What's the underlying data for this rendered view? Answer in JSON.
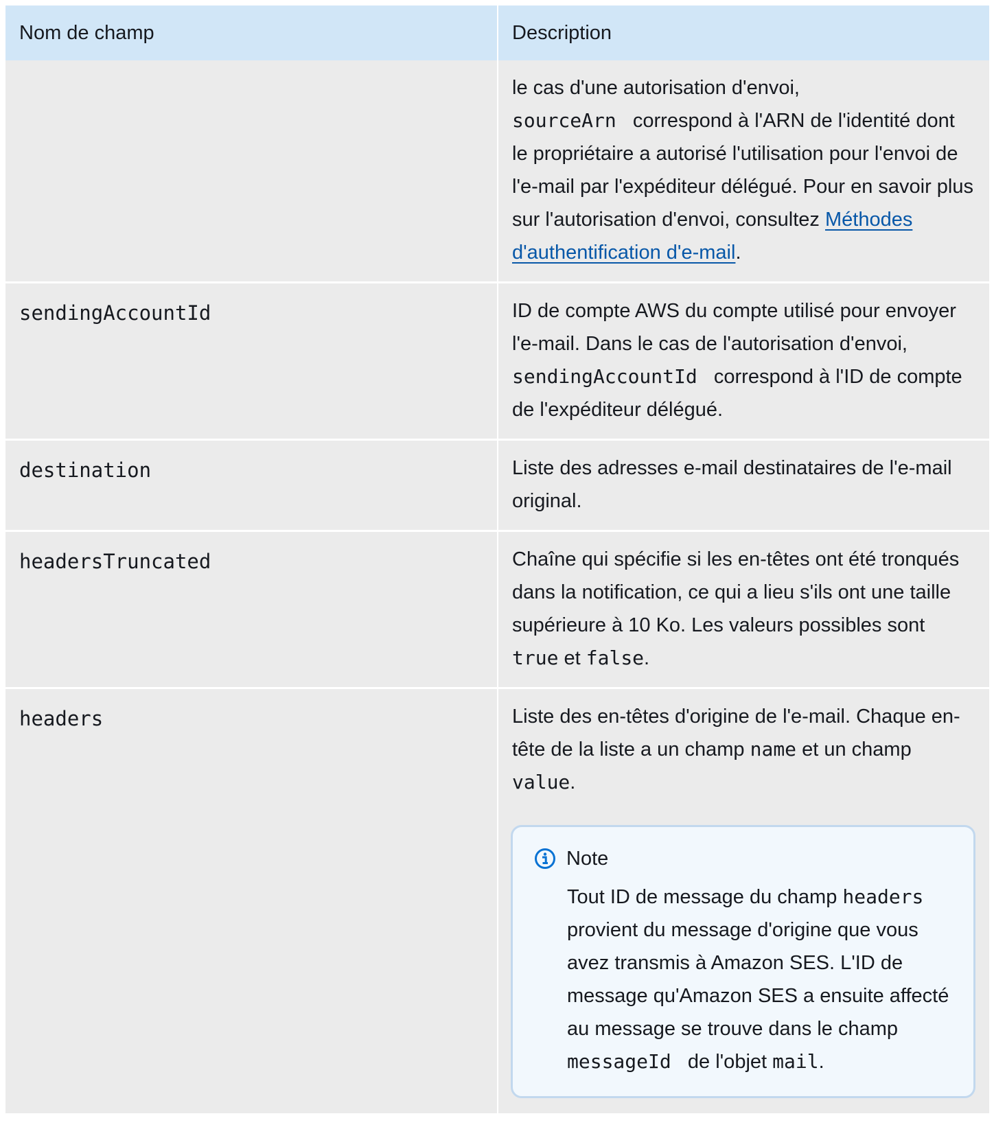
{
  "table": {
    "headers": {
      "field": "Nom de champ",
      "description": "Description"
    },
    "row0": {
      "t1": "le cas d'une autorisation d'envoi,",
      "c1": "sourceArn",
      "t2": "correspond à l'ARN de l'identité dont le propriétaire a autorisé l'utilisation pour l'envoi de l'e-mail par l'expéditeur délégué. Pour en savoir plus sur l'autorisation d'envoi, consultez",
      "link": "Méthodes d'authentification d'e-mail",
      "t3": "."
    },
    "row1": {
      "name": "sendingAccountId",
      "t1": "ID de compte AWS du compte utilisé pour envoyer l'e-mail. Dans le cas de l'autorisation d'envoi,",
      "c1": "sendingAccountId",
      "t2": "correspond à l'ID de compte de l'expéditeur délégué."
    },
    "row2": {
      "name": "destination",
      "t1": "Liste des adresses e-mail destinataires de l'e-mail original."
    },
    "row3": {
      "name": "headersTruncated",
      "t1": "Chaîne qui spécifie si les en-têtes ont été tronqués dans la notification, ce qui a lieu s'ils ont une taille supérieure à 10 Ko. Les valeurs possibles sont",
      "c1": "true",
      "t2": "et",
      "c2": "false",
      "t3": "."
    },
    "row4": {
      "name": "headers",
      "t1": "Liste des en-têtes d'origine de l'e-mail. Chaque en-tête de la liste a un champ",
      "c1": "name",
      "t2": "et un champ",
      "c2": "value",
      "t3": ".",
      "note": {
        "icon": "info-icon",
        "title": "Note",
        "t1": "Tout ID de message du champ",
        "c1": "headers",
        "t2": "provient du message d'origine que vous avez transmis à Amazon SES. L'ID de message qu'Amazon SES a ensuite affecté au message se trouve dans le champ",
        "c2": "messageId",
        "t3": "de l'objet",
        "c3": "mail",
        "t4": "."
      }
    }
  },
  "colors": {
    "header_bg": "#d1e6f7",
    "row_bg": "#ebebeb",
    "link": "#0757a8",
    "note_bg": "#f2f8fd",
    "note_border": "#c2d8ee",
    "icon": "#0972d3"
  }
}
